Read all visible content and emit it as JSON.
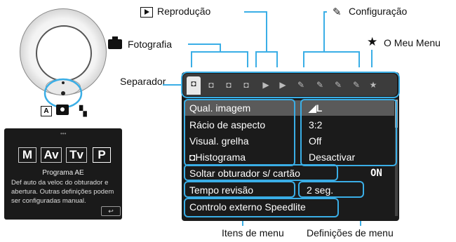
{
  "callouts": {
    "playback": "Reprodução",
    "setup": "Configuração",
    "shooting": "Fotografia",
    "mymenu": "O Meu Menu",
    "separator": "Separador",
    "menu_items": "Itens de menu",
    "menu_settings": "Definições de menu"
  },
  "dial": {
    "mode_a_label": "A"
  },
  "mode_screen": {
    "modes": [
      "M",
      "Av",
      "Tv",
      "P"
    ],
    "title": "Programa AE",
    "description": "Def auto da veloc do obturador e abertura. Outras definições podem ser configuradas manual.",
    "back_icon": "↩"
  },
  "menu": {
    "tabs": [
      {
        "icon": "camera-icon",
        "symbol": "◘",
        "sub": ""
      },
      {
        "icon": "camera-icon",
        "symbol": "◘",
        "sub": "·"
      },
      {
        "icon": "camera-icon",
        "symbol": "◘",
        "sub": "··"
      },
      {
        "icon": "camera-icon",
        "symbol": "◘",
        "sub": "⁘"
      },
      {
        "icon": "play-icon",
        "symbol": "▶",
        "sub": ""
      },
      {
        "icon": "play-icon",
        "symbol": "▶",
        "sub": "·"
      },
      {
        "icon": "wrench-icon",
        "symbol": "✎",
        "sub": ""
      },
      {
        "icon": "wrench-icon",
        "symbol": "✎",
        "sub": "·"
      },
      {
        "icon": "wrench-icon",
        "symbol": "✎",
        "sub": "··"
      },
      {
        "icon": "wrench-icon",
        "symbol": "✎",
        "sub": "⁘"
      },
      {
        "icon": "star-icon",
        "symbol": "★",
        "sub": ""
      }
    ],
    "items": [
      {
        "label": "Qual. imagem",
        "value": "◢L",
        "selected": true
      },
      {
        "label": "Rácio de aspecto",
        "value": "3:2",
        "selected": false
      },
      {
        "label": "Visual. grelha",
        "value": "Off",
        "selected": false
      },
      {
        "label": "◘Histograma",
        "value": "Desactivar",
        "selected": false
      },
      {
        "label": "Soltar obturador s/ cartão",
        "value": "ON",
        "selected": false
      },
      {
        "label": "Tempo revisão",
        "value": "2 seg.",
        "selected": false
      },
      {
        "label": "Controlo externo Speedlite",
        "value": "",
        "selected": false
      }
    ]
  },
  "colors": {
    "highlight": "#3aaee6",
    "menu_bg": "#1b1b1b",
    "selected_row": "#5a5a5a",
    "row": "#2b2b2b"
  }
}
